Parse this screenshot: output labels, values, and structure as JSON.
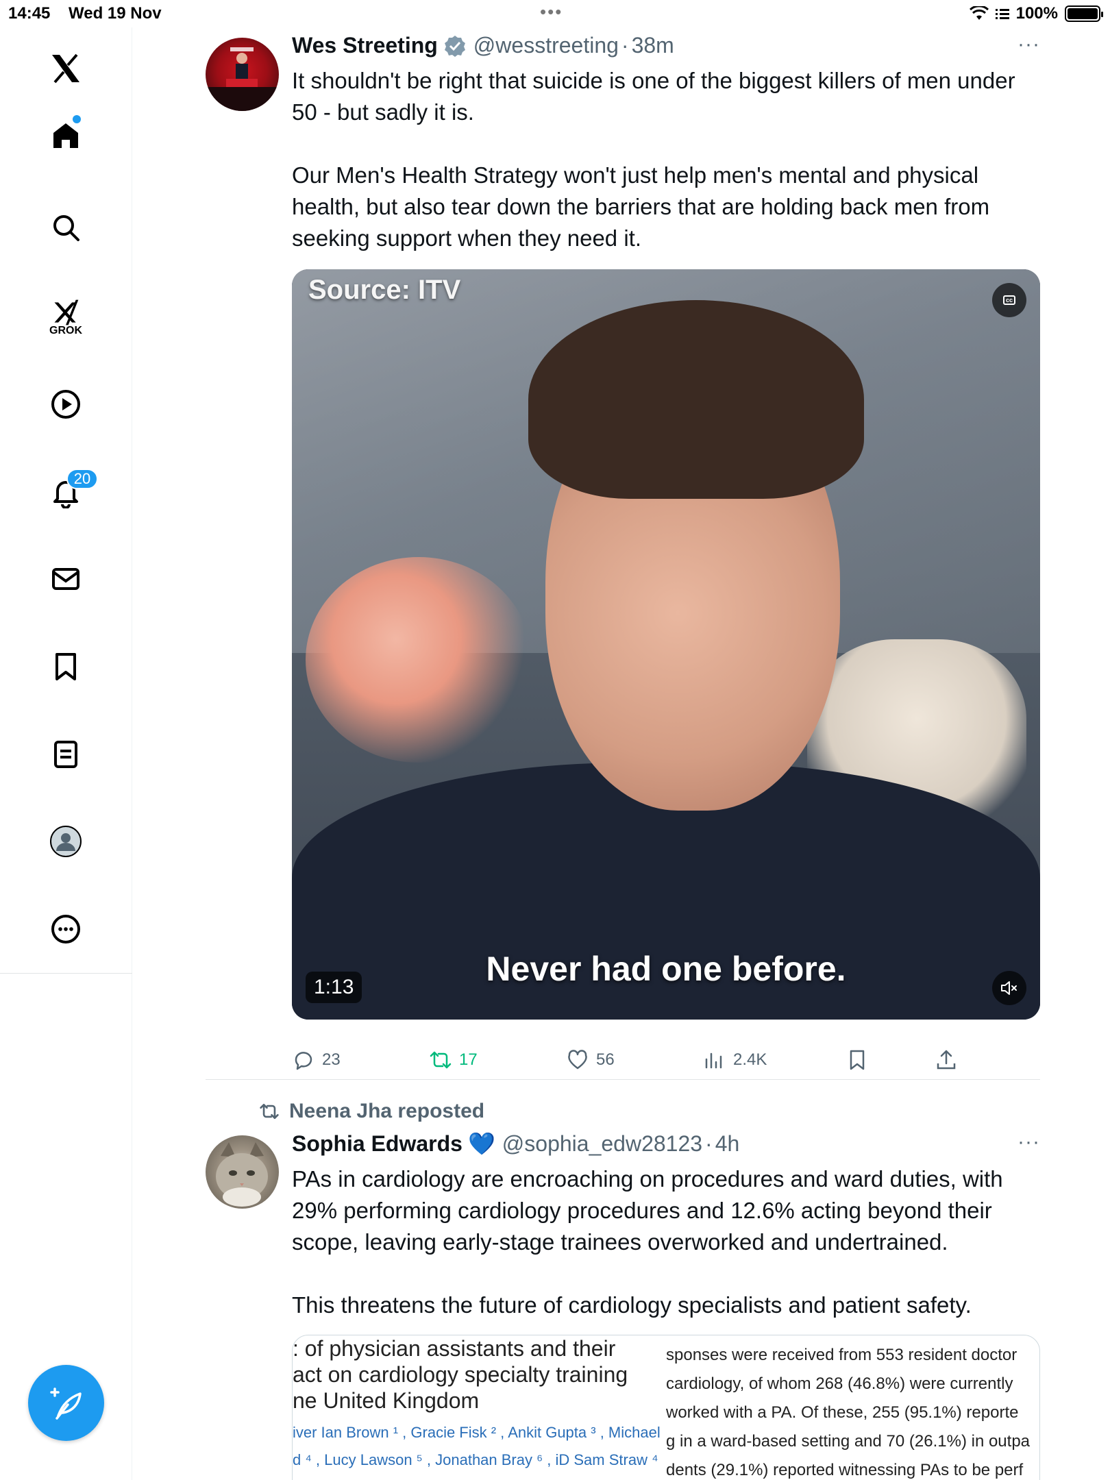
{
  "status_bar": {
    "time": "14:45",
    "date": "Wed 19 Nov",
    "battery": "100%"
  },
  "sidebar": {
    "logo": "𝕏",
    "items": [
      {
        "name": "home",
        "icon": "home-icon",
        "has_dot": true
      },
      {
        "name": "explore",
        "icon": "search-icon"
      },
      {
        "name": "grok",
        "icon": "grok-icon",
        "label": "GROK"
      },
      {
        "name": "videos",
        "icon": "play-icon"
      },
      {
        "name": "notifications",
        "icon": "bell-icon",
        "badge": "20"
      },
      {
        "name": "messages",
        "icon": "mail-icon"
      },
      {
        "name": "bookmarks",
        "icon": "bookmark-icon"
      },
      {
        "name": "lists",
        "icon": "list-icon"
      },
      {
        "name": "profile",
        "icon": "profile-icon"
      },
      {
        "name": "more",
        "icon": "more-circle-icon"
      }
    ],
    "compose_icon": "compose-feather-icon"
  },
  "tweet1": {
    "name": "Wes Streeting",
    "verified": true,
    "handle": "@wesstreeting",
    "time": "38m",
    "more": "···",
    "text": "It shouldn't be right that suicide is one of the biggest killers of men under 50 - but sadly it is.\n\nOur Men's Health Strategy won't just help men's mental and physical health, but also tear down the barriers that are holding back men from seeking support when they need it.",
    "video": {
      "source": "Source: ITV",
      "caption": "Never had one before.",
      "duration": "1:13",
      "cc_label": "cc"
    },
    "actions": {
      "replies": "23",
      "reposts": "17",
      "likes": "56",
      "views": "2.4K"
    }
  },
  "tweet2": {
    "reposted_by": "Neena Jha reposted",
    "name": "Sophia Edwards",
    "emoji": "💙",
    "handle": "@sophia_edw28123",
    "time": "4h",
    "more": "···",
    "text": "PAs in cardiology are encroaching on procedures and ward duties, with 29% performing cardiology procedures and 12.6% acting beyond their scope, leaving early-stage trainees overworked and undertrained.\n\nThis threatens the future of cardiology specialists and patient safety.",
    "card": {
      "paper_title": ": of physician assistants and their\nact on cardiology specialty training\nne United Kingdom",
      "authors": "iver Ian Brown ¹ , Gracie Fisk ² , Ankit Gupta ³ , Michael\nd ⁴ , Lucy Lawson ⁵ , Jonathan Bray ⁶ , iD Sam Straw ⁴ ,",
      "abstract": "sponses were received from 553 resident doctor\n cardiology, of whom 268 (46.8%) were currently\n worked with a PA. Of these, 255 (95.1%) reporte\ng in a ward-based setting and 70 (26.1%) in outpa\ndents (29.1%) reported witnessing PAs to be perf"
    }
  }
}
